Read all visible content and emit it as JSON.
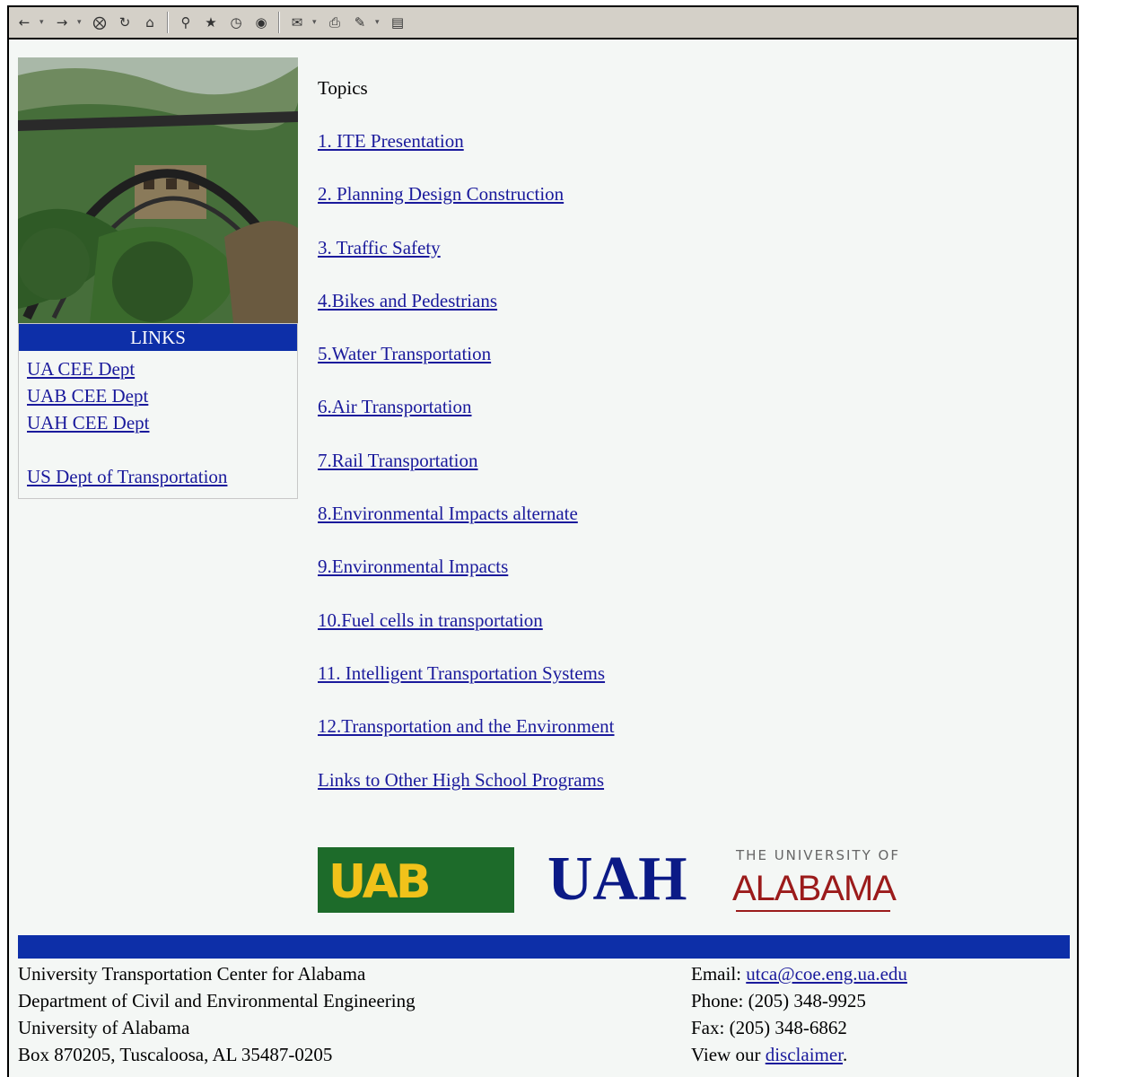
{
  "toolbar": {
    "buttons": [
      "back-icon",
      "forward-icon",
      "stop-icon",
      "refresh-icon",
      "home-icon",
      "search-icon",
      "favorites-icon",
      "history-icon",
      "channels-icon",
      "mail-icon",
      "print-icon",
      "edit-icon",
      "discuss-icon"
    ]
  },
  "sidebar": {
    "header": "LINKS",
    "links": [
      "UA CEE Dept",
      "UAB CEE Dept",
      "UAH CEE Dept",
      "US Dept of Transportation"
    ]
  },
  "main": {
    "topics_title": "Topics",
    "topics": [
      "1. ITE Presentation",
      "2. Planning Design Construction",
      "3. Traffic Safety",
      "4.Bikes and Pedestrians",
      "5.Water Transportation",
      "6.Air Transportation",
      "7.Rail Transportation",
      "8.Environmental Impacts alternate",
      "9.Environmental Impacts",
      "10.Fuel cells in transportation",
      "11. Intelligent Transportation Systems",
      "12.Transportation and the Environment",
      "Links to Other High School Programs"
    ]
  },
  "logos": {
    "uab": "UAB",
    "uah": "UAH",
    "ua_top": "THE UNIVERSITY OF",
    "ua_main": "ALABAMA"
  },
  "footer": {
    "address": [
      "University Transportation Center for Alabama",
      "Department of Civil and Environmental Engineering",
      "University of Alabama",
      "Box 870205, Tuscaloosa, AL 35487-0205"
    ],
    "email_label": "Email: ",
    "email": "utca@coe.eng.ua.edu",
    "phone": "Phone: (205) 348-9925",
    "fax": "Fax: (205) 348-6862",
    "disclaimer_prefix": "View our ",
    "disclaimer_link": "disclaimer",
    "disclaimer_suffix": "."
  },
  "colors": {
    "accent_blue": "#0d2fa8",
    "link": "#1a1a9c",
    "uab_green": "#1d6b2a",
    "uab_gold": "#f1c21a",
    "ua_crimson": "#9b1b1b"
  }
}
